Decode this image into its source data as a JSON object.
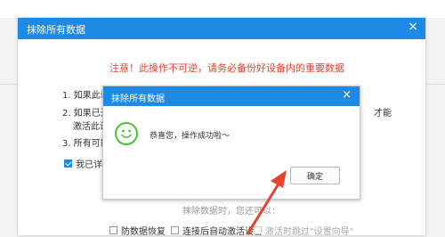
{
  "outer_dialog": {
    "title": "抹除所有数据",
    "close": "×",
    "warning": "注意！此操作不可逆，请务必备份好设备内的重要数据",
    "items": [
      "1. 如果此设",
      "2. 如果已开",
      "激活此设",
      "3. 所有可能"
    ],
    "trailing_fragment": "才能",
    "read_confirm_label": "我已详细",
    "hint": "抹除数据时，您还可以：",
    "options": [
      {
        "label": "防数据恢复",
        "checked": false
      },
      {
        "label": "连接后自动激活设备",
        "checked": false
      },
      {
        "label": "激活时跳过\"设置向导\"",
        "checked": false
      }
    ]
  },
  "inner_dialog": {
    "title": "抹除所有数据",
    "close": "×",
    "message": "恭喜您，操作成功啦～",
    "confirm_label": "确定"
  },
  "colors": {
    "accent": "#1e8ae6",
    "warning": "#e8412c",
    "success": "#4bbf3c",
    "arrow": "#e8412c"
  },
  "icons": {
    "smiley": "smiley-face-icon",
    "arrow": "red-arrow-pointer"
  }
}
